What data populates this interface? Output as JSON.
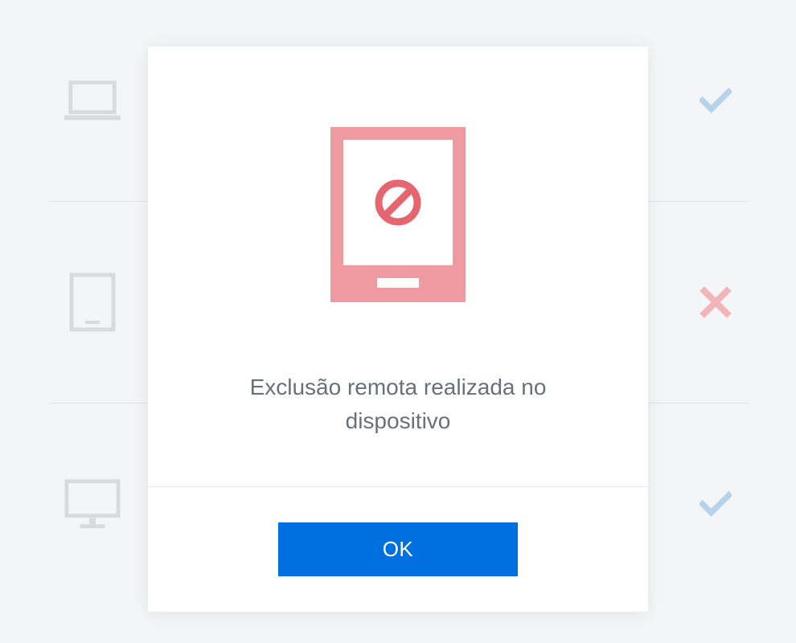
{
  "devices": [
    {
      "type": "laptop",
      "status": "check"
    },
    {
      "type": "tablet",
      "status": "cross"
    },
    {
      "type": "desktop",
      "status": "check"
    }
  ],
  "modal": {
    "message": "Exclusão remota realizada no dispositivo",
    "ok_label": "OK"
  },
  "colors": {
    "accent_blue": "#0070e0",
    "check_blue": "#b7d3ec",
    "cross_pink": "#f1b4b8",
    "icon_gray": "#d8dadd",
    "device_pink_fill": "#ef9aa0",
    "device_pink_stroke": "#ea868d",
    "prohibit_red": "#e56670"
  }
}
